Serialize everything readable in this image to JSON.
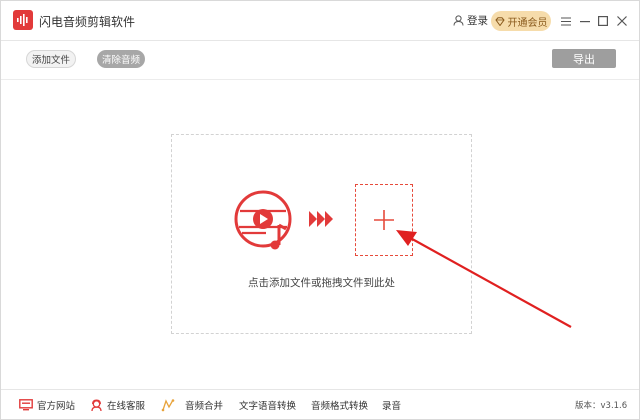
{
  "window": {
    "title": "闪电音频剪辑软件"
  },
  "header": {
    "login_label": "登录",
    "vip_label": "开通会员"
  },
  "toolbar": {
    "add_file_label": "添加文件",
    "clear_audio_label": "清除音频",
    "export_label": "导出"
  },
  "drop_area": {
    "hint": "点击添加文件或拖拽文件到此处"
  },
  "bottom": {
    "items": [
      {
        "label": "官方网站",
        "icon": "monitor-icon"
      },
      {
        "label": "在线客服",
        "icon": "headset-icon"
      },
      {
        "label": "音频合并",
        "icon": "merge-icon"
      },
      {
        "label": "文字语音转换"
      },
      {
        "label": "音频格式转换"
      },
      {
        "label": "录音"
      }
    ],
    "version": "版本：v3.1.6"
  },
  "colors": {
    "accent_red": "#e23a3a",
    "vip_bg": "#f6dcab",
    "export_bg": "#9e9e9e"
  }
}
